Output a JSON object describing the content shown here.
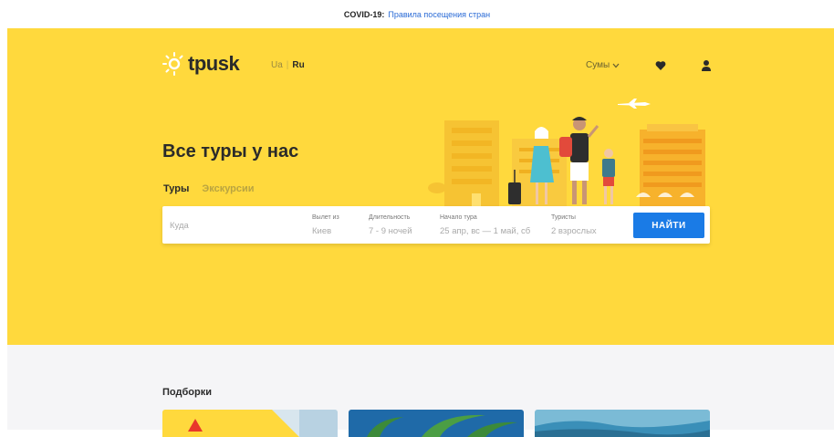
{
  "banner": {
    "label": "COVID-19:",
    "link": "Правила посещения стран"
  },
  "header": {
    "logo_text": "tpusk",
    "lang_ua": "Ua",
    "lang_ru": "Ru",
    "city": "Сумы"
  },
  "hero": {
    "title": "Все туры у нас",
    "tabs": [
      {
        "label": "Туры"
      },
      {
        "label": "Экскурсии"
      }
    ]
  },
  "search": {
    "to_placeholder": "Куда",
    "from_label": "Вылет из",
    "from_value": "Киев",
    "duration_label": "Длительность",
    "duration_value": "7 - 9 ночей",
    "start_label": "Начало тура",
    "start_value": "25 апр, вс — 1 май, сб",
    "tourists_label": "Туристы",
    "tourists_value": "2 взрослых",
    "find_label": "НАЙТИ"
  },
  "collections": {
    "title": "Подборки"
  },
  "colors": {
    "brand_yellow": "#ffd93d",
    "accent_blue": "#1a7be6"
  }
}
